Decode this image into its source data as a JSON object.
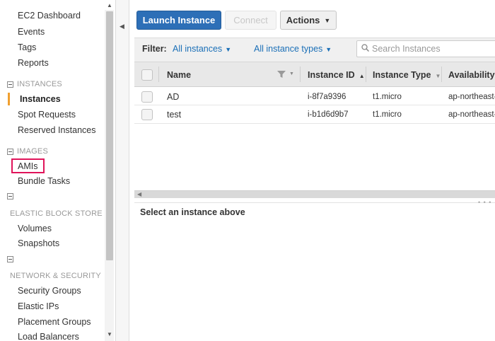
{
  "sidebar": {
    "top_items": [
      "EC2 Dashboard",
      "Events",
      "Tags",
      "Reports"
    ],
    "instances_header": "INSTANCES",
    "instances_items": [
      "Instances",
      "Spot Requests",
      "Reserved Instances"
    ],
    "images_header": "IMAGES",
    "images_items": [
      "AMIs",
      "Bundle Tasks"
    ],
    "ebs_header": "ELASTIC BLOCK STORE",
    "ebs_items": [
      "Volumes",
      "Snapshots"
    ],
    "network_header": "NETWORK & SECURITY",
    "network_items": [
      "Security Groups",
      "Elastic IPs",
      "Placement Groups",
      "Load Balancers"
    ],
    "active_item": "Instances",
    "highlighted_item": "AMIs"
  },
  "toolbar": {
    "launch_label": "Launch Instance",
    "connect_label": "Connect",
    "actions_label": "Actions"
  },
  "filter": {
    "label": "Filter:",
    "instances_filter": "All instances",
    "types_filter": "All instance types",
    "search_placeholder": "Search Instances"
  },
  "table": {
    "columns": [
      "Name",
      "Instance ID",
      "Instance Type",
      "Availability"
    ],
    "rows": [
      {
        "name": "AD",
        "id": "i-8f7a9396",
        "type": "t1.micro",
        "az": "ap-northeast-"
      },
      {
        "name": "test",
        "id": "i-b1d6d9b7",
        "type": "t1.micro",
        "az": "ap-northeast-"
      }
    ]
  },
  "detail": {
    "message": "Select an instance above"
  },
  "colors": {
    "primary_button": "#2d6fb7",
    "link": "#1a6fb7",
    "active_indicator": "#f0a030",
    "highlight_box": "#e0145a"
  }
}
